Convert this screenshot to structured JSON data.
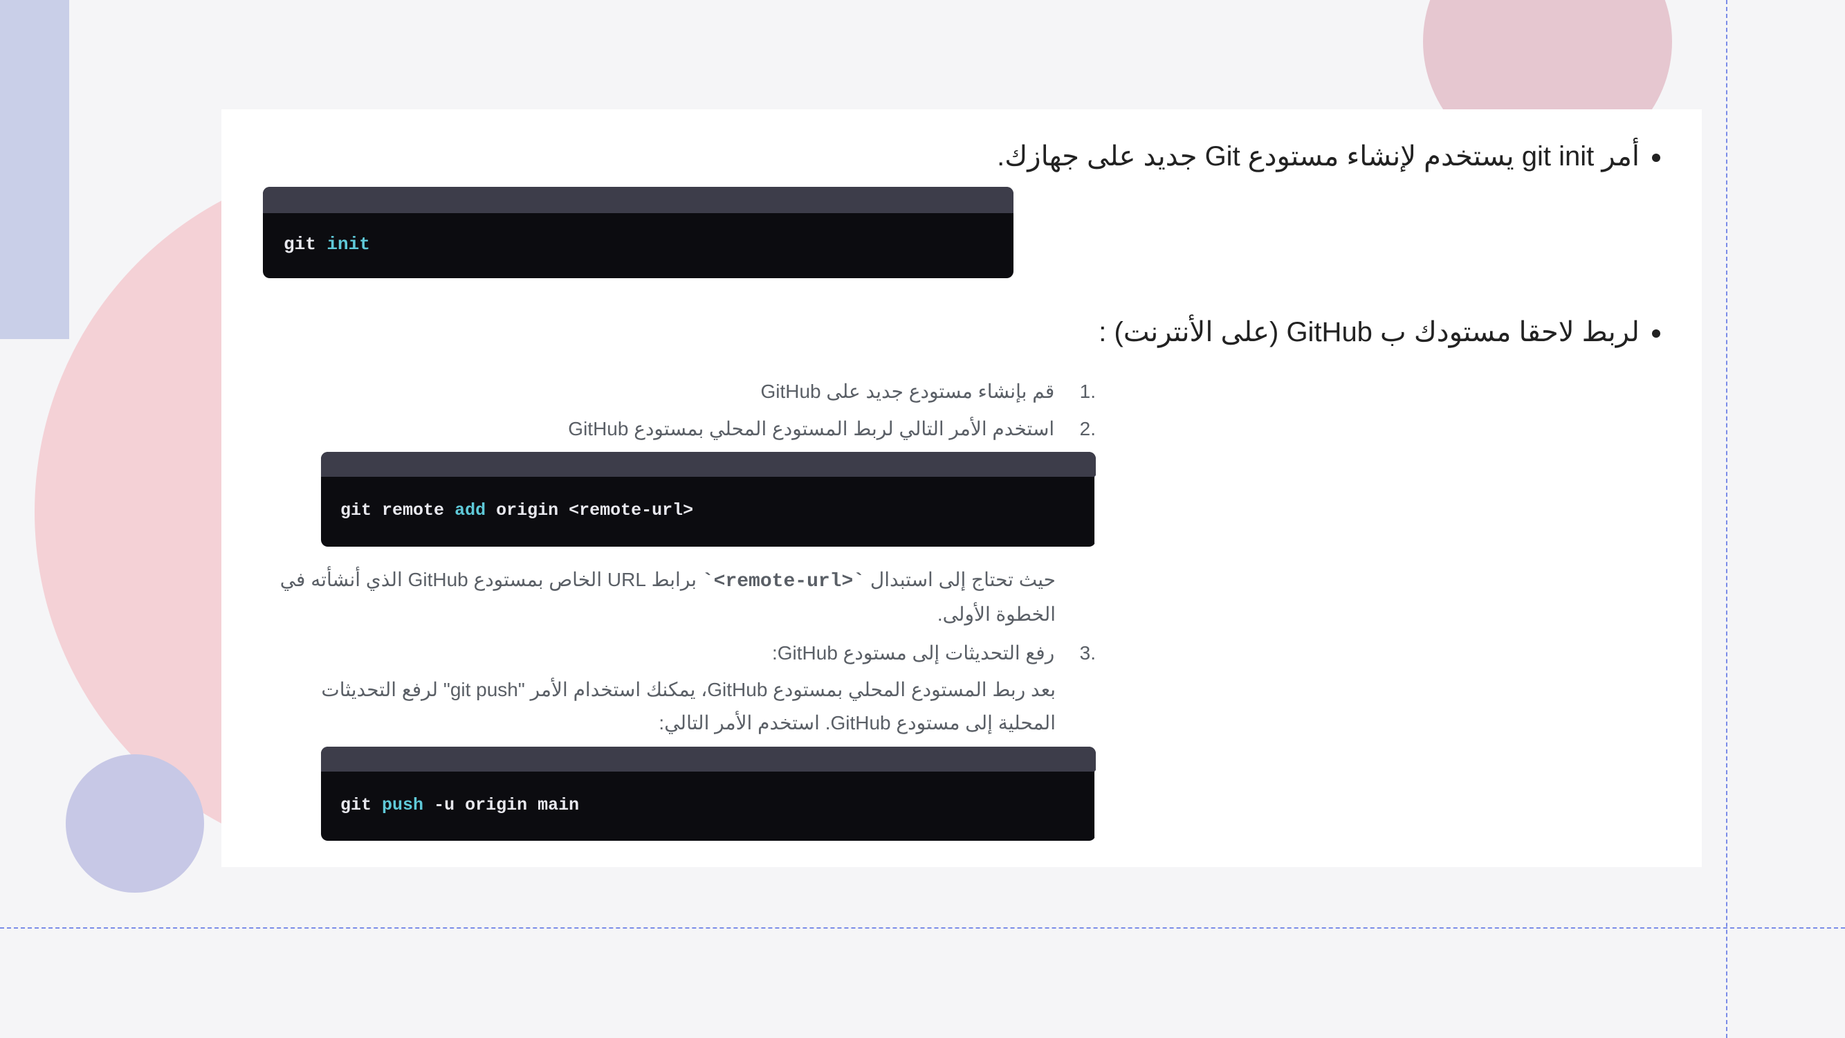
{
  "bullets": {
    "b1": "أمر git init يستخدم لإنشاء مستودع Git جديد على جهازك.",
    "b2": "لربط لاحقا مستودك ب GitHub (على الأنترنت) :"
  },
  "code_git_init": {
    "cmd": "git",
    "sub": "init"
  },
  "steps": {
    "s1_num": "1.",
    "s1_text": "قم بإنشاء مستودع جديد على GitHub",
    "s2_num": "2.",
    "s2_text": "استخدم الأمر التالي لربط المستودع المحلي بمستودع GitHub",
    "s2_code": {
      "cmd": "git",
      "remote": "remote",
      "add": "add",
      "origin": "origin",
      "placeholder": "<remote-url>"
    },
    "s2_subtext_a": "حيث تحتاج إلى استبدال ",
    "s2_subtext_code": "`<remote-url>`",
    "s2_subtext_b": " برابط URL الخاص بمستودع GitHub الذي أنشأته في الخطوة الأولى.",
    "s3_num": "3.",
    "s3_text": "رفع التحديثات إلى مستودع GitHub:",
    "s3_subtext": "بعد ربط المستودع المحلي بمستودع GitHub، يمكنك استخدام الأمر \"git push\" لرفع التحديثات المحلية إلى مستودع GitHub. استخدم الأمر التالي:",
    "s3_code": {
      "cmd": "git",
      "push": "push",
      "flag": "-u",
      "origin": "origin",
      "branch": "main"
    }
  }
}
